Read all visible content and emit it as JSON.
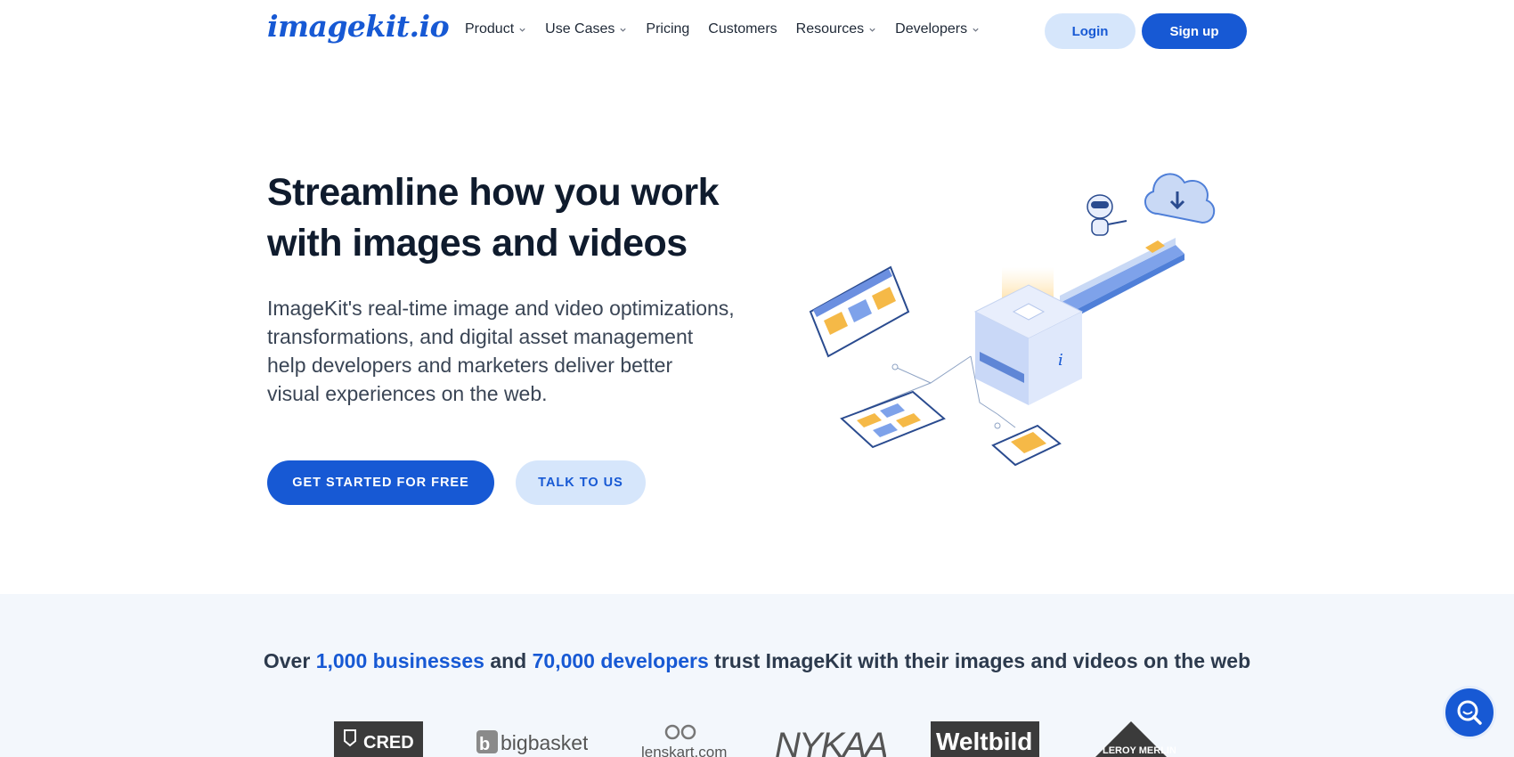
{
  "header": {
    "logo": "imagekit.io",
    "nav": [
      {
        "label": "Product",
        "has_dropdown": true
      },
      {
        "label": "Use Cases",
        "has_dropdown": true
      },
      {
        "label": "Pricing",
        "has_dropdown": false
      },
      {
        "label": "Customers",
        "has_dropdown": false
      },
      {
        "label": "Resources",
        "has_dropdown": true
      },
      {
        "label": "Developers",
        "has_dropdown": true
      }
    ],
    "login_label": "Login",
    "signup_label": "Sign up"
  },
  "hero": {
    "title_line1": "Streamline how you work",
    "title_line2": "with images and videos",
    "subtitle_line1": "ImageKit's real-time image and video optimizations,",
    "subtitle_line2": "transformations, and digital asset management",
    "subtitle_line3": "help developers and marketers deliver better",
    "subtitle_line4": "visual experiences on the web.",
    "cta_primary": "GET STARTED FOR FREE",
    "cta_secondary": "TALK TO US"
  },
  "trust": {
    "prefix": "Over ",
    "businesses": "1,000 businesses",
    "and": " and ",
    "developers": "70,000 developers",
    "suffix": " trust ImageKit with their images and videos on the web",
    "logos": [
      "CRED",
      "bigbasket",
      "lenskart.com",
      "NYKAA",
      "Weltbild",
      "LEROY MERLIN"
    ]
  },
  "colors": {
    "brand": "#1759d4",
    "brand_light": "#d6e6fb",
    "text_dark": "#0f1b2d",
    "band_bg": "#f3f7fc"
  },
  "icons": {
    "chat": "chat-search-icon",
    "dropdown": "chevron-down-icon"
  }
}
